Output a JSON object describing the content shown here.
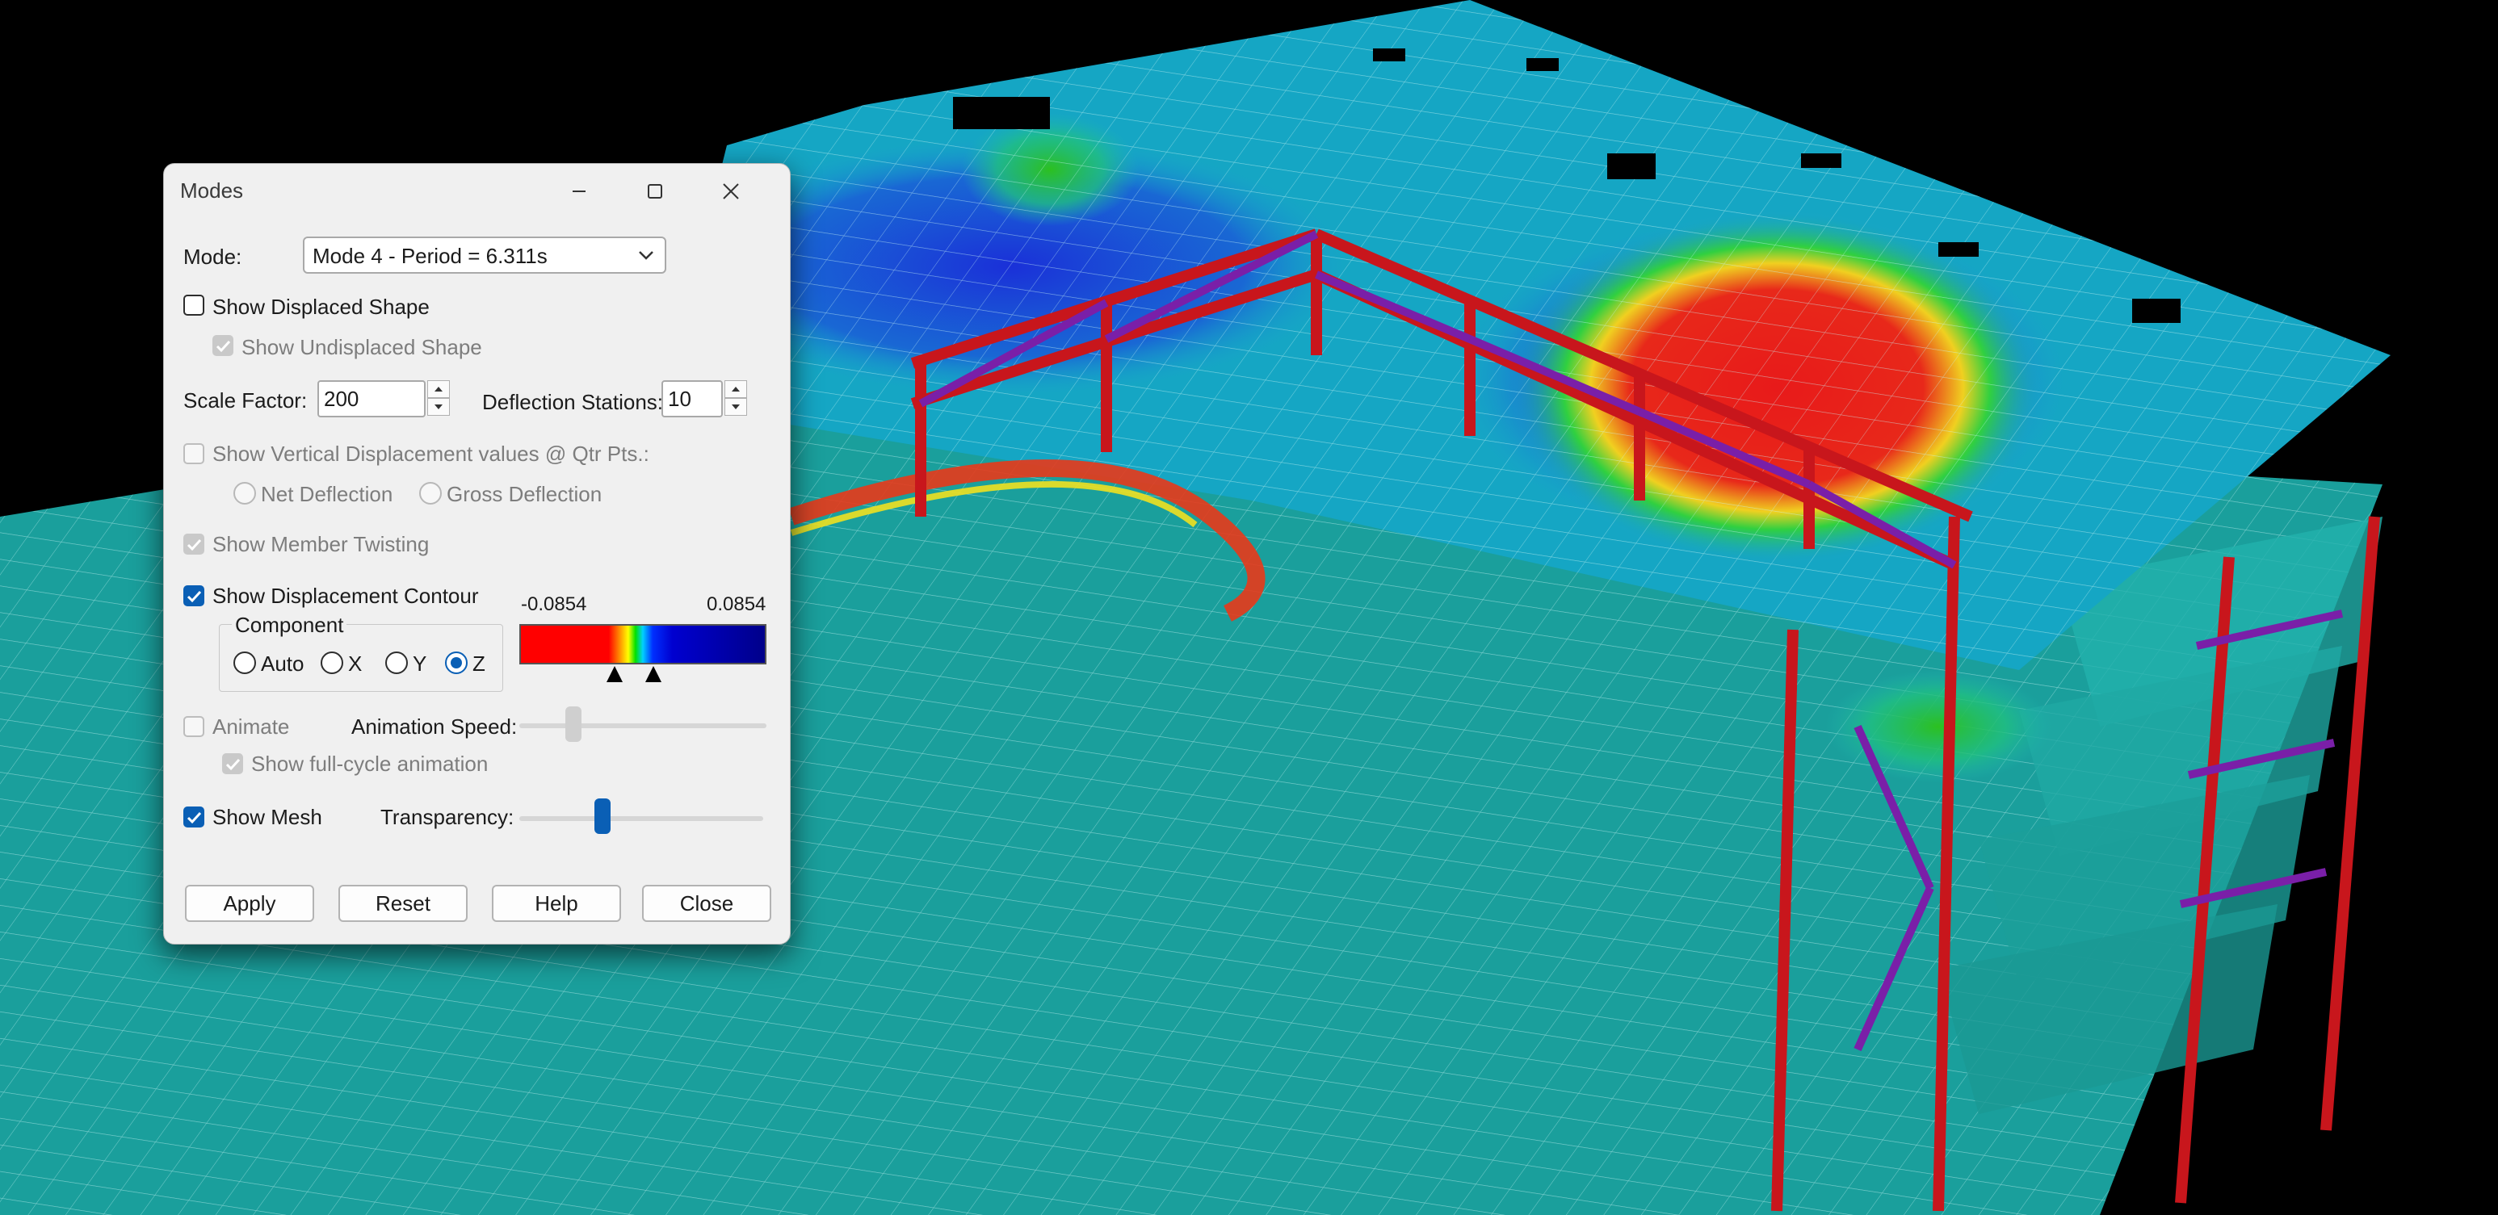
{
  "dialog": {
    "title": "Modes",
    "mode_label": "Mode:",
    "mode_value": "Mode 4 - Period = 6.311s",
    "show_displaced_shape": {
      "label": "Show Displaced Shape",
      "checked": false
    },
    "show_undisplaced_shape": {
      "label": "Show Undisplaced Shape",
      "checked": true,
      "disabled": true
    },
    "scale_factor": {
      "label": "Scale Factor:",
      "value": "200"
    },
    "deflection_stations": {
      "label": "Deflection Stations:",
      "value": "10"
    },
    "show_vertical_displacement": {
      "label": "Show Vertical Displacement values @ Qtr Pts.:",
      "checked": false,
      "disabled": true
    },
    "net_deflection": "Net Deflection",
    "gross_deflection": "Gross Deflection",
    "show_member_twisting": {
      "label": "Show Member Twisting",
      "checked": true,
      "disabled": true
    },
    "show_displacement_contour": {
      "label": "Show Displacement Contour",
      "checked": true
    },
    "component": {
      "label": "Component",
      "options": [
        "Auto",
        "X",
        "Y",
        "Z"
      ],
      "selected": "Z"
    },
    "contour_range": {
      "min": "-0.0854",
      "max": "0.0854"
    },
    "animate": {
      "label": "Animate",
      "checked": false,
      "disabled": true
    },
    "animation_speed_label": "Animation Speed:",
    "show_full_cycle": {
      "label": "Show full-cycle animation",
      "checked": true,
      "disabled": true
    },
    "show_mesh": {
      "label": "Show Mesh",
      "checked": true
    },
    "transparency_label": "Transparency:",
    "transparency_level": 0.33,
    "animation_speed_level": 0.2,
    "buttons": {
      "apply": "Apply",
      "reset": "Reset",
      "help": "Help",
      "close": "Close"
    }
  },
  "colors": {
    "background": "#000000",
    "accent": "#0a5fb5",
    "slab": "#1fb7b0",
    "frame": "#c8161c",
    "brace": "#7a1fa8"
  }
}
